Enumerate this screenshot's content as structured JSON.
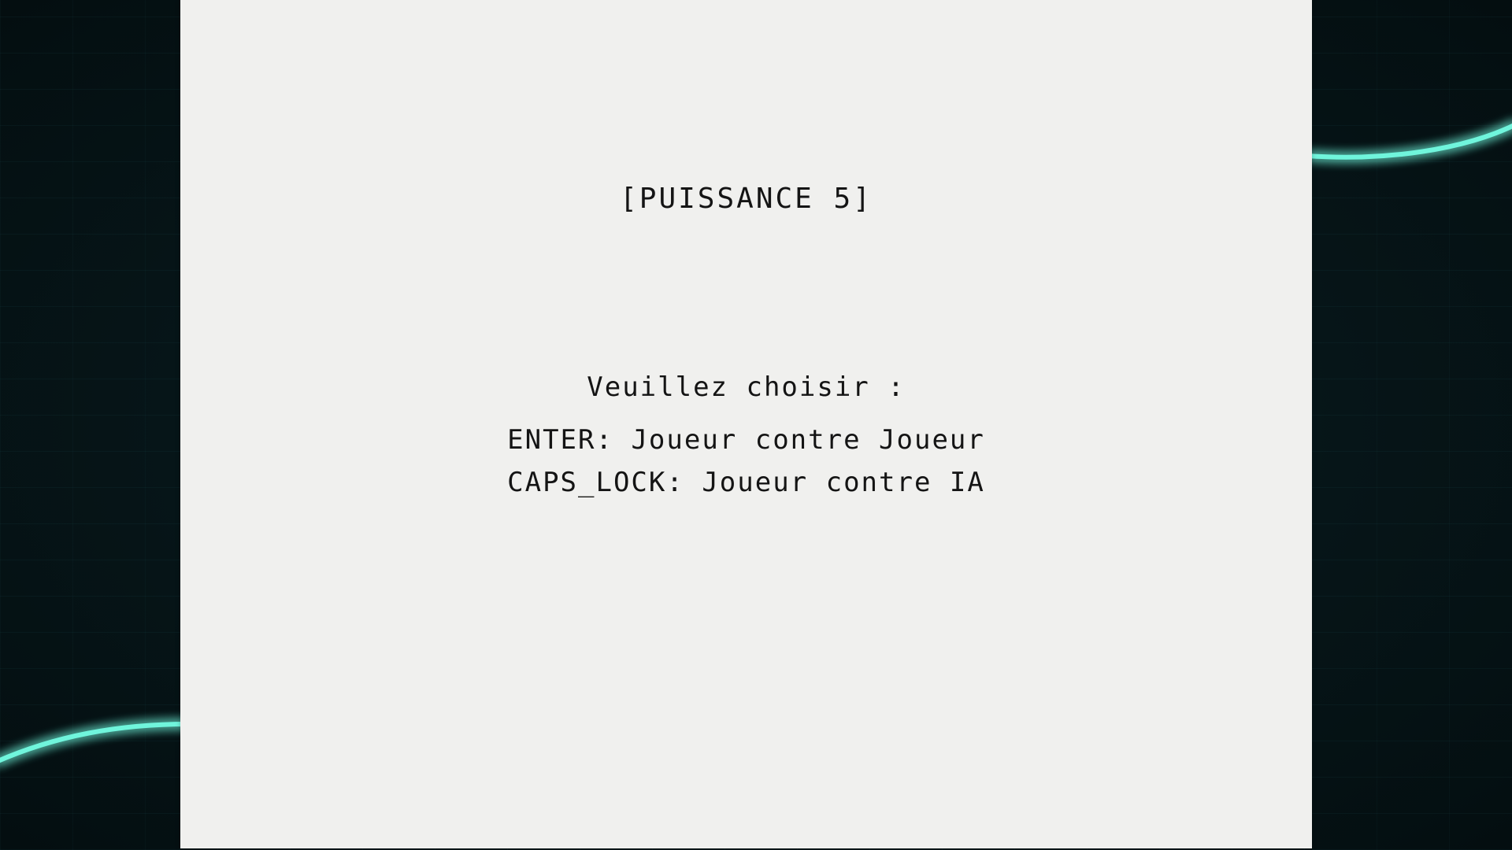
{
  "game": {
    "title": "[PUISSANCE 5]",
    "prompt": "Veuillez choisir :",
    "options": [
      {
        "key": "ENTER",
        "label": "Joueur contre Joueur"
      },
      {
        "key": "CAPS_LOCK",
        "label": "Joueur contre IA"
      }
    ],
    "separator": ": "
  },
  "colors": {
    "panel": "#f0f0ee",
    "text": "#141414",
    "background": "#061416",
    "neon": "#5ff2d6"
  }
}
